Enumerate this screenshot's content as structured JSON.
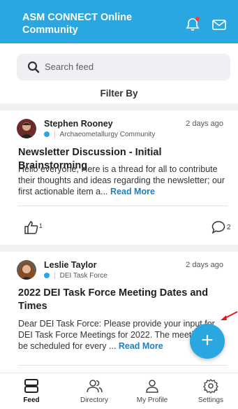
{
  "header": {
    "title": "ASM CONNECT Online Community",
    "bell_icon": "bell-icon",
    "mail_icon": "mail-icon"
  },
  "search": {
    "placeholder": "Search feed"
  },
  "filter_label": "Filter By",
  "posts": [
    {
      "author": "Stephen Rooney",
      "time": "2 days ago",
      "community": "Archaeometallurgy Community",
      "title": "Newsletter Discussion - Initial Brainstorming",
      "excerpt": "Hello everyone, Here is a thread for all to contribute their thoughts and ideas regarding the newsletter; our first actionable item a...",
      "read_more": "Read More",
      "likes": "1",
      "comments": "2"
    },
    {
      "author": "Leslie Taylor",
      "time": "2 days ago",
      "community": "DEI Task Force",
      "title": "2022 DEI Task Force Meeting Dates and Times",
      "excerpt": "Dear DEI Task Force: Please provide your input for DEI Task Force Meetings for 2022. The meetings will be scheduled for every ...",
      "read_more": "Read More"
    }
  ],
  "fab": {
    "label": "+"
  },
  "nav": [
    {
      "label": "Feed",
      "icon": "feed-icon"
    },
    {
      "label": "Directory",
      "icon": "directory-icon"
    },
    {
      "label": "My Profile",
      "icon": "profile-icon"
    },
    {
      "label": "Settings",
      "icon": "settings-icon"
    }
  ],
  "colors": {
    "accent": "#2aa6e0",
    "link": "#1d7fc0",
    "annotation_arrow": "#e8141b"
  }
}
